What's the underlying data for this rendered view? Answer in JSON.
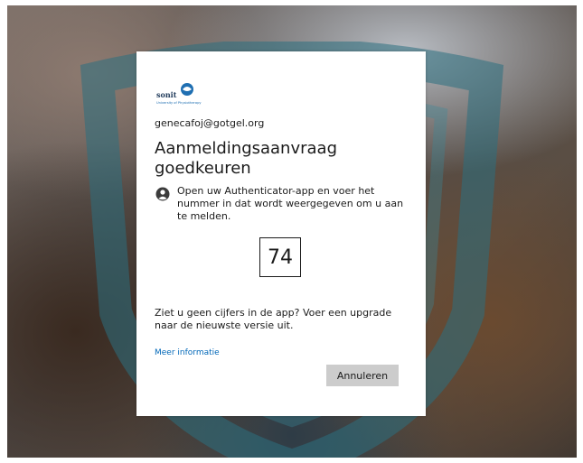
{
  "logo": {
    "name": "sonit",
    "subtitle": "University of Physiotherapy"
  },
  "account": {
    "email": "genecafoj@gotgel.org"
  },
  "dialog": {
    "title": "Aanmeldingsaanvraag goedkeuren",
    "instruction_icon": "user-lock-icon",
    "instruction": "Open uw Authenticator-app en voer het nummer in dat wordt weergegeven om u aan te melden.",
    "code": "74",
    "upgrade_note": "Ziet u geen cijfers in de app? Voer een upgrade naar de nieuwste versie uit.",
    "more_info_link": "Meer informatie",
    "cancel_label": "Annuleren"
  },
  "colors": {
    "link": "#0067b8",
    "button_bg": "#cccccc",
    "text": "#1b1b1b",
    "logo_blue": "#1f6fb2"
  }
}
